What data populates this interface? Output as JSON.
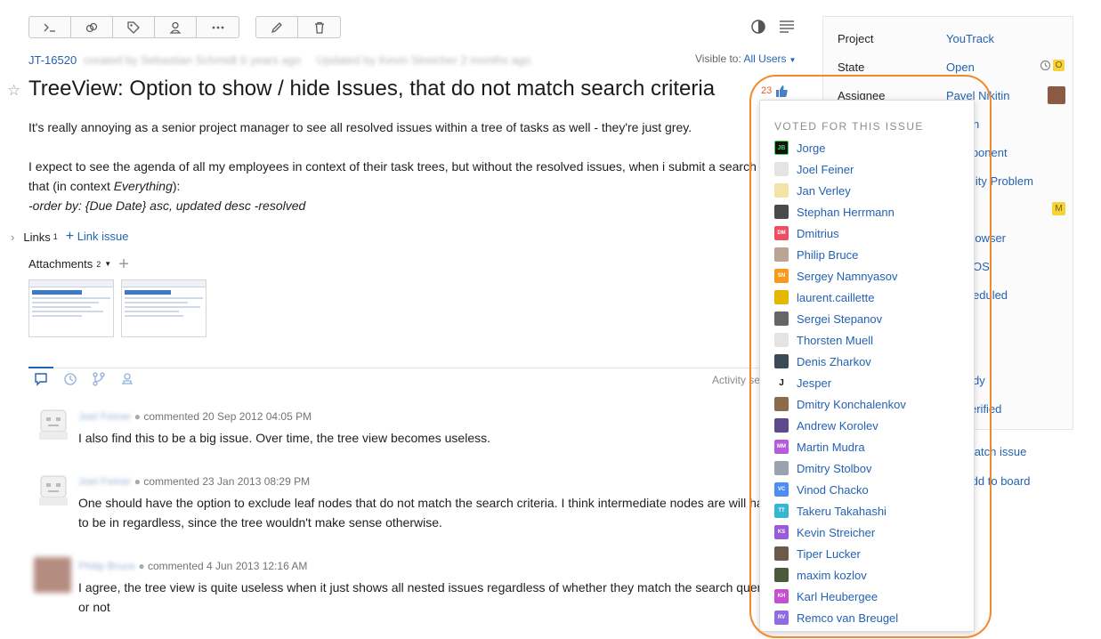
{
  "issue": {
    "id": "JT-16520",
    "created_by": "created by Sebastian Schmidt 6 years ago",
    "updated_by": "Updated by Kevin Streicher 2 months ago",
    "visible_label": "Visible to:",
    "visible_value": "All Users",
    "title": "TreeView: Option to show / hide Issues, that do not match search criteria",
    "votes": "23",
    "description": [
      "It's really annoying as a senior project manager to see all resolved issues within a tree of tasks as well - they're just grey.",
      "I expect to see the agenda of all my employees in context of their task trees, but without the resolved issues, when i submit a search",
      "that (in context ",
      "Everything",
      "):",
      "-order by: {Due Date} asc, updated desc -resolved"
    ],
    "links_label": "Links",
    "links_count": "1",
    "link_issue": "Link issue",
    "attachments_label": "Attachments",
    "attachments_count": "2"
  },
  "properties": [
    {
      "label": "Project",
      "value": "YouTrack"
    },
    {
      "label": "State",
      "value": "Open",
      "badge": "O"
    },
    {
      "label": "Assignee",
      "value": "Pavel Nikitin"
    },
    {
      "label": "",
      "value": "h"
    },
    {
      "label": "",
      "value": "mponent"
    },
    {
      "label": "",
      "value": "lity Problem"
    },
    {
      "label": "",
      "value": "",
      "badge": "M"
    },
    {
      "label": "",
      "value": "rowser"
    },
    {
      "label": "",
      "value": "OS"
    },
    {
      "label": "",
      "value": "eduled"
    },
    {
      "label": "",
      "value": "dy"
    },
    {
      "label": "",
      "value": "erified"
    }
  ],
  "side_actions": [
    "Watch issue",
    "Add to board"
  ],
  "activity_label": "Activity se",
  "votes_popup": {
    "header": "VOTED FOR THIS ISSUE",
    "voters": [
      {
        "name": "Jorge",
        "initials": "JB",
        "color": "#111111"
      },
      {
        "name": "Joel Feiner",
        "initials": "",
        "color": "#e4e4e4"
      },
      {
        "name": "Jan Verley",
        "initials": "",
        "color": "#f4e3a6"
      },
      {
        "name": "Stephan Herrmann",
        "initials": "",
        "color": "#4a4a4a"
      },
      {
        "name": "Dmitrius",
        "initials": "DM",
        "color": "#ec4f63"
      },
      {
        "name": "Philip Bruce",
        "initials": "",
        "color": "#b9a496"
      },
      {
        "name": "Sergey Namnyasov",
        "initials": "SN",
        "color": "#f79b1c"
      },
      {
        "name": "laurent.caillette",
        "initials": "",
        "color": "#e5b800"
      },
      {
        "name": "Sergei Stepanov",
        "initials": "",
        "color": "#666666"
      },
      {
        "name": "Thorsten Muell",
        "initials": "",
        "color": "#e4e4e4"
      },
      {
        "name": "Denis Zharkov",
        "initials": "",
        "color": "#3c4a57"
      },
      {
        "name": "Jesper",
        "initials": "J",
        "color": "#ffffff"
      },
      {
        "name": "Dmitry Konchalenkov",
        "initials": "",
        "color": "#8b6b4a"
      },
      {
        "name": "Andrew Korolev",
        "initials": "",
        "color": "#5d4a8a"
      },
      {
        "name": "Martin Mudra",
        "initials": "MM",
        "color": "#b65bd9"
      },
      {
        "name": "Dmitry Stolbov",
        "initials": "",
        "color": "#9aa3ad"
      },
      {
        "name": "Vinod Chacko",
        "initials": "VC",
        "color": "#4f8ef0"
      },
      {
        "name": "Takeru Takahashi",
        "initials": "TT",
        "color": "#37b6d1"
      },
      {
        "name": "Kevin Streicher",
        "initials": "KS",
        "color": "#9a5bd9"
      },
      {
        "name": "Tiper Lucker",
        "initials": "",
        "color": "#6b5a4a"
      },
      {
        "name": "maxim kozlov",
        "initials": "",
        "color": "#4a5a3a"
      },
      {
        "name": "Karl Heubergee",
        "initials": "KH",
        "color": "#c44fd0"
      },
      {
        "name": "Remco van Breugel",
        "initials": "RV",
        "color": "#8f6de0"
      }
    ]
  },
  "comments": [
    {
      "author": "Joel Feiner",
      "meta": "commented 20 Sep 2012 04:05 PM",
      "lines": [
        "I also find this to be a big issue. Over time, the tree view becomes useless."
      ]
    },
    {
      "author": "Joel Feiner",
      "meta": "commented 23 Jan 2013 08:29 PM",
      "lines": [
        "One should have the option to exclude leaf nodes that do not match the search criteria. I think intermediate nodes are will ha",
        "to be in regardless, since the tree wouldn't make sense otherwise."
      ]
    },
    {
      "author": "Philip Bruce",
      "meta": "commented 4 Jun 2013 12:16 AM",
      "lines": [
        "I agree, the tree view is quite useless when it just shows all nested issues regardless of whether they match the search quer",
        "or not"
      ]
    }
  ]
}
